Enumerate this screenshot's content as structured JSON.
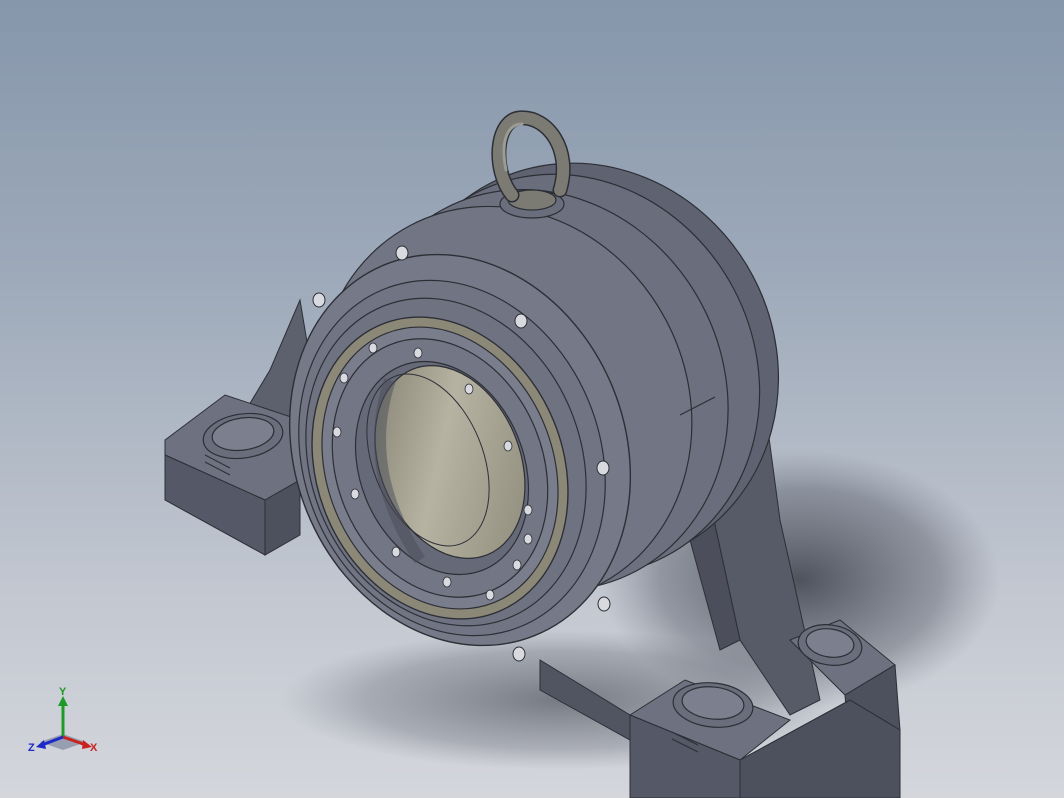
{
  "view": {
    "model_description": "pillow-block-bearing-housing",
    "colors": {
      "background_top": "#8696ab",
      "background_bottom": "#d4d6dc",
      "housing": "#6c6f7e",
      "housing_dark": "#4e505c",
      "bore": "#a7a493",
      "eyebolt": "#7b7a73"
    }
  },
  "triad": {
    "x_label": "X",
    "y_label": "Y",
    "z_label": "Z",
    "x_color": "#c8231e",
    "y_color": "#1e9a28",
    "z_color": "#1e2ac8"
  }
}
